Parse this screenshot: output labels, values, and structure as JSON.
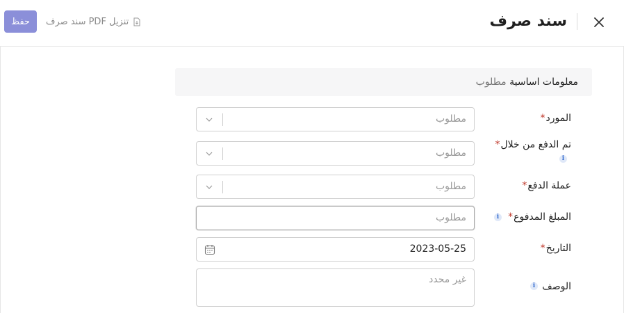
{
  "header": {
    "title": "سند صرف",
    "download_label": "تنزيل PDF سند صرف",
    "save_label": "حفظ"
  },
  "section": {
    "title": "معلومات اساسية",
    "subtitle": "مطلوب"
  },
  "fields": {
    "supplier": {
      "label": "المورد",
      "required_mark": "*",
      "placeholder": "مطلوب"
    },
    "paid_via": {
      "label": "تم الدفع من خلال",
      "required_mark": "*",
      "placeholder": "مطلوب"
    },
    "currency": {
      "label": "عملة الدفع",
      "required_mark": "*",
      "placeholder": "مطلوب"
    },
    "amount": {
      "label": "المبلغ المدفوع",
      "required_mark": "*",
      "placeholder": "مطلوب"
    },
    "date": {
      "label": "التاريخ",
      "required_mark": "*",
      "value": "2023-05-25"
    },
    "description": {
      "label": "الوصف",
      "placeholder": "غير محدد"
    }
  },
  "icons": {
    "close": "close-icon",
    "download": "file-download-icon",
    "info": "info-icon",
    "chevron": "chevron-down-icon",
    "calendar": "calendar-icon"
  },
  "colors": {
    "accent": "#8b8fd9",
    "required": "#c0392b",
    "info": "#3a6fd0"
  }
}
